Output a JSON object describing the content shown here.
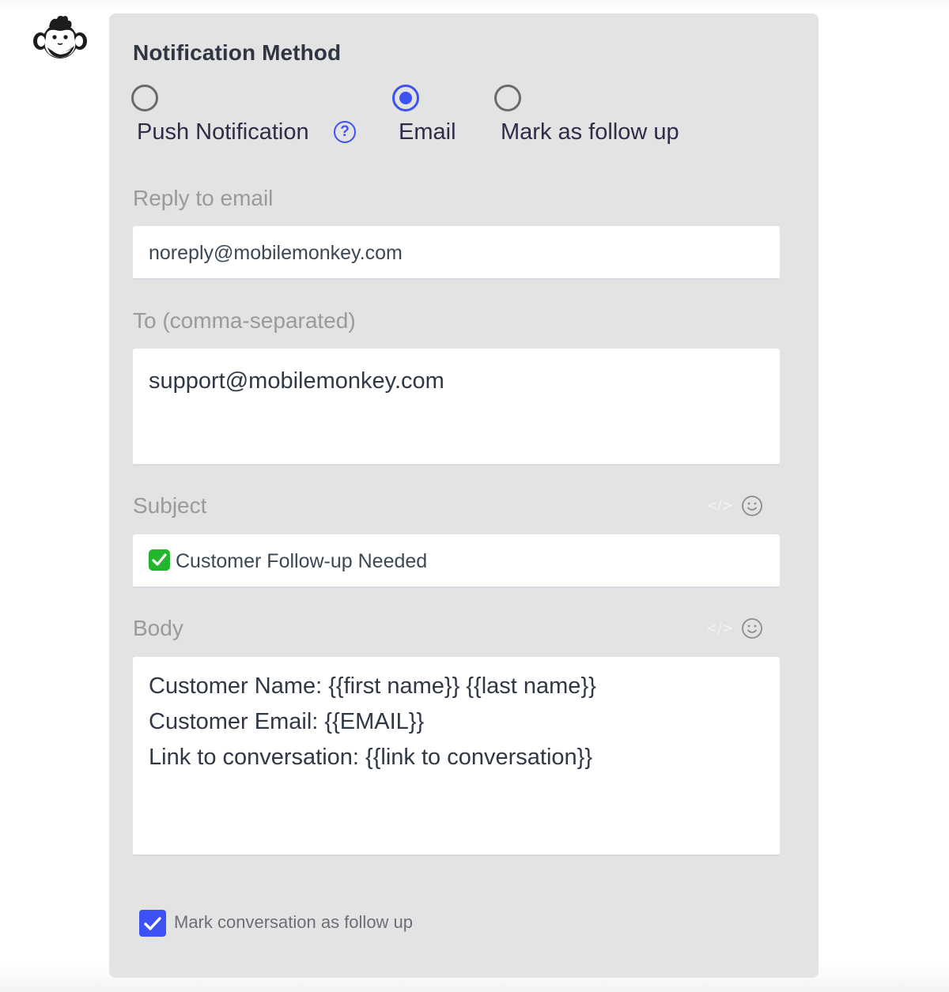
{
  "logo": {
    "icon": "monkey-face-icon"
  },
  "notification": {
    "title": "Notification Method",
    "methods": [
      {
        "label": "Push Notification",
        "selected": false,
        "help_icon": "question-circle-icon",
        "help_glyph": "?"
      },
      {
        "label": "Email",
        "selected": true
      },
      {
        "label": "Mark as follow up",
        "selected": false
      }
    ]
  },
  "form": {
    "reply_to": {
      "label": "Reply to email",
      "value": "noreply@mobilemonkey.com"
    },
    "to": {
      "label": "To (comma-separated)",
      "value": "support@mobilemonkey.com"
    },
    "subject": {
      "label": "Subject",
      "emoji": "check-mark-button-emoji",
      "value": "Customer Follow-up Needed",
      "tools": [
        "code-icon",
        "emoji-smiley-icon"
      ],
      "code_glyph": "</>"
    },
    "body": {
      "label": "Body",
      "lines": [
        "Customer Name: {{first name}} {{last name}}",
        "Customer Email: {{EMAIL}}",
        "Link to conversation: {{link to conversation}}"
      ],
      "tools": [
        "code-icon",
        "emoji-smiley-icon"
      ],
      "code_glyph": "</>"
    }
  },
  "follow_up_checkbox": {
    "label": "Mark conversation as follow up",
    "checked": true
  },
  "colors": {
    "accent": "#3d52f5",
    "panel_bg": "#e3e3e3",
    "label_gray": "#9a9a9a",
    "text_dark": "#2f3542"
  }
}
